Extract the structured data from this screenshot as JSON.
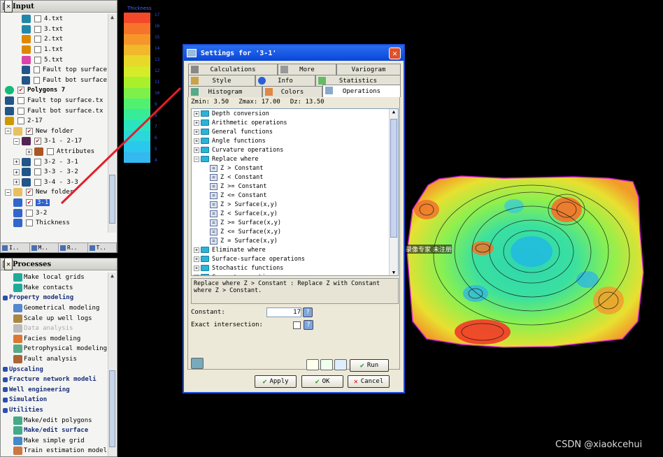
{
  "input_pane": {
    "title": "Input",
    "items": [
      {
        "label": "4.txt",
        "checked": false,
        "bold": false
      },
      {
        "label": "3.txt",
        "checked": false,
        "bold": false
      },
      {
        "label": "2.txt",
        "checked": false,
        "bold": false
      },
      {
        "label": "1.txt",
        "checked": false,
        "bold": false
      },
      {
        "label": "5.txt",
        "checked": false,
        "bold": false
      },
      {
        "label": "Fault top surface",
        "checked": false,
        "bold": false
      },
      {
        "label": "Fault bot surface",
        "checked": false,
        "bold": false
      },
      {
        "label": "Polygons 7",
        "checked": true,
        "bold": true
      },
      {
        "label": "Fault top surface.tx",
        "checked": false,
        "bold": false
      },
      {
        "label": "Fault bot surface.tx",
        "checked": false,
        "bold": false
      },
      {
        "label": "2-17",
        "checked": false,
        "bold": false
      },
      {
        "label": "New folder",
        "checked": true,
        "bold": false
      },
      {
        "label": "3-1 - 2-17",
        "checked": true,
        "bold": false
      },
      {
        "label": "Attributes",
        "checked": false,
        "bold": false
      },
      {
        "label": "3-2 - 3-1",
        "checked": false,
        "bold": false
      },
      {
        "label": "3-3 - 3-2",
        "checked": false,
        "bold": false
      },
      {
        "label": "3-4 - 3-3",
        "checked": false,
        "bold": false
      },
      {
        "label": "New folder",
        "checked": true,
        "bold": false
      },
      {
        "label": "3-1",
        "checked": true,
        "bold": false
      },
      {
        "label": "3-2",
        "checked": false,
        "bold": false
      },
      {
        "label": "Thickness",
        "checked": false,
        "bold": false
      }
    ],
    "bottom_tabs": [
      "I..",
      "M..",
      "R..",
      "T.."
    ]
  },
  "processes_pane": {
    "title": "Processes",
    "items": [
      {
        "label": "Make local grids",
        "bold": false
      },
      {
        "label": "Make contacts",
        "bold": false
      },
      {
        "label": "Property modeling",
        "bold": true
      },
      {
        "label": "Geometrical modeling",
        "bold": false
      },
      {
        "label": "Scale up well logs",
        "bold": false
      },
      {
        "label": "Data analysis",
        "bold": false
      },
      {
        "label": "Facies modeling",
        "bold": false
      },
      {
        "label": "Petrophysical modeling",
        "bold": false
      },
      {
        "label": "Fault analysis",
        "bold": false
      },
      {
        "label": "Upscaling",
        "bold": true
      },
      {
        "label": "Fracture network modeli",
        "bold": true
      },
      {
        "label": "Well engineering",
        "bold": true
      },
      {
        "label": "Simulation",
        "bold": true
      },
      {
        "label": "Utilities",
        "bold": true
      },
      {
        "label": "Make/edit polygons",
        "bold": false
      },
      {
        "label": "Make/edit surface",
        "bold": true
      },
      {
        "label": "Make simple grid",
        "bold": false
      },
      {
        "label": "Train estimation model",
        "bold": false
      }
    ]
  },
  "colorbar": {
    "label": "Thickness",
    "ticks": [
      "17",
      "16",
      "15",
      "14",
      "13",
      "12",
      "11",
      "10",
      "9",
      "8",
      "7",
      "6",
      "5",
      "4"
    ],
    "colors": [
      "#f3492a",
      "#f6742a",
      "#f6962a",
      "#f0b82a",
      "#e8d82a",
      "#d4ec2a",
      "#aaf02a",
      "#7ef04a",
      "#52f070",
      "#36ec98",
      "#2ae4c0",
      "#2ad8dc",
      "#2ac8ec",
      "#34b8f0"
    ]
  },
  "dialog": {
    "title": "Settings for '3-1'",
    "tabs_row1": [
      "Calculations",
      "More",
      "Variogram"
    ],
    "tabs_row2": [
      "Style",
      "Info",
      "Statistics"
    ],
    "tabs_row3": [
      "Histogram",
      "Colors",
      "Operations"
    ],
    "zmin_label": "Zmin:",
    "zmin": "3.50",
    "zmax_label": "Zmax:",
    "zmax": "17.00",
    "dz_label": "Dz:",
    "dz": "13.50",
    "tree": [
      {
        "label": "Depth conversion",
        "kind": "folder"
      },
      {
        "label": "Arithmetic operations",
        "kind": "folder"
      },
      {
        "label": "General functions",
        "kind": "folder"
      },
      {
        "label": "Angle functions",
        "kind": "folder"
      },
      {
        "label": "Curvature operations",
        "kind": "folder"
      },
      {
        "label": "Replace where",
        "kind": "folder-open"
      },
      {
        "label": "Z > Constant",
        "kind": "op"
      },
      {
        "label": "Z < Constant",
        "kind": "op"
      },
      {
        "label": "Z >= Constant",
        "kind": "op"
      },
      {
        "label": "Z <= Constant",
        "kind": "op"
      },
      {
        "label": "Z > Surface(x,y)",
        "kind": "op"
      },
      {
        "label": "Z < Surface(x,y)",
        "kind": "op"
      },
      {
        "label": "Z >= Surface(x,y)",
        "kind": "op"
      },
      {
        "label": "Z <= Surface(x,y)",
        "kind": "op"
      },
      {
        "label": "Z = Surface(x,y)",
        "kind": "op"
      },
      {
        "label": "Eliminate where",
        "kind": "folder"
      },
      {
        "label": "Surface-surface operations",
        "kind": "folder"
      },
      {
        "label": "Stochastic functions",
        "kind": "folder"
      },
      {
        "label": "Convert operations",
        "kind": "folder"
      }
    ],
    "description": "Replace where Z > Constant : Replace Z with Constant where Z > Constant.",
    "constant_label": "Constant:",
    "constant_value": "17",
    "exact_label": "Exact intersection:",
    "run_label": "Run",
    "apply_label": "Apply",
    "ok_label": "OK",
    "cancel_label": "Cancel"
  },
  "overlay_text": "屏幕录像专家 未注册",
  "watermark": "CSDN @xiaokcehui"
}
